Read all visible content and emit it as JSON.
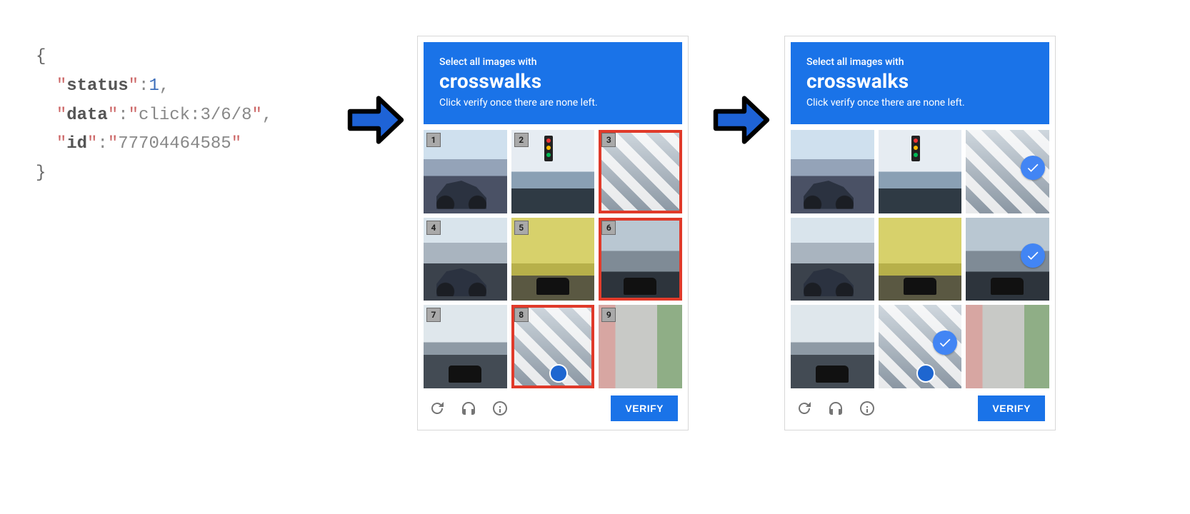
{
  "json_payload": {
    "open": "{",
    "close": "}",
    "pairs": [
      {
        "key": "status",
        "value": 1,
        "type": "number"
      },
      {
        "key": "data",
        "value": "click:3/6/8",
        "type": "string"
      },
      {
        "key": "id",
        "value": "77704464585",
        "type": "string"
      }
    ]
  },
  "captcha": {
    "header": {
      "prompt_line": "Select all images with",
      "target": "crosswalks",
      "instruction": "Click verify once there are none left."
    },
    "tiles": [
      {
        "n": 1,
        "scene": "sc-street1",
        "overlay": "ov-bike"
      },
      {
        "n": 2,
        "scene": "sc-street2",
        "overlay": "ov-light"
      },
      {
        "n": 3,
        "scene": "sc-crosswalk",
        "overlay": ""
      },
      {
        "n": 4,
        "scene": "sc-moto",
        "overlay": "ov-bike"
      },
      {
        "n": 5,
        "scene": "sc-tunnel",
        "overlay": "ov-car"
      },
      {
        "n": 6,
        "scene": "sc-car",
        "overlay": "ov-car"
      },
      {
        "n": 7,
        "scene": "sc-road",
        "overlay": "ov-car"
      },
      {
        "n": 8,
        "scene": "sc-crosswalk",
        "overlay": "ov-sign"
      },
      {
        "n": 9,
        "scene": "sc-build",
        "overlay": ""
      }
    ],
    "highlighted": [
      3,
      6,
      8
    ],
    "checked": [
      3,
      6,
      8
    ],
    "verify_label": "VERIFY",
    "icons": [
      "reload-icon",
      "headphones-icon",
      "info-icon"
    ]
  },
  "colors": {
    "accent": "#1a73e8",
    "arrow_fill": "#1e63d6",
    "arrow_stroke": "#000000",
    "highlight": "#e03a2a",
    "check_bg": "#4285f4"
  }
}
